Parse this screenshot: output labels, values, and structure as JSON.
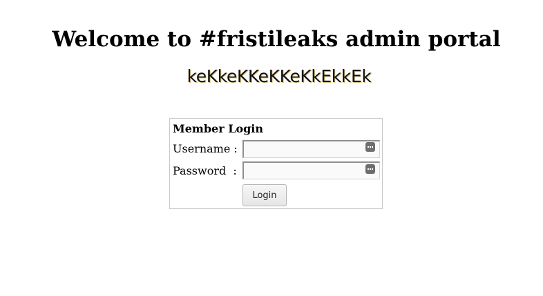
{
  "page": {
    "heading": "Welcome to #fristileaks admin portal",
    "logo_text": "keKkeKKeKKeKkEkkEk"
  },
  "login_form": {
    "title": "Member Login",
    "username_label": "Username :",
    "password_label": "Password  :",
    "username_value": "",
    "password_value": "",
    "submit_label": "Login",
    "autofill_icon": "password-manager-key-icon"
  },
  "colors": {
    "background": "#ffffff",
    "form_border": "#c8c8c8",
    "input_background": "#fafafa",
    "autofill_icon": "#6e6e6e"
  }
}
